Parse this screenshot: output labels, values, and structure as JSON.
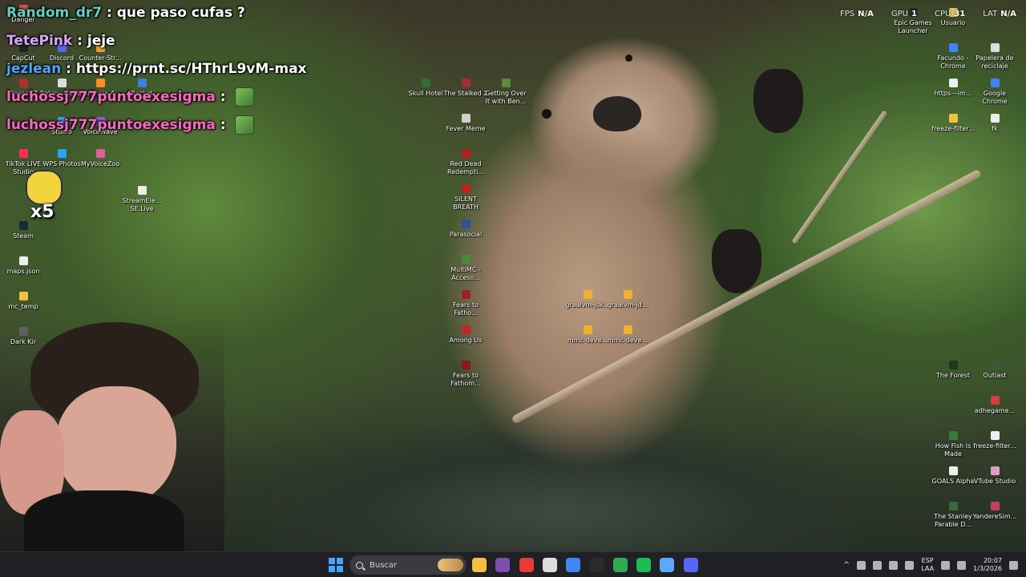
{
  "chat": {
    "messages": [
      {
        "user": "Random_dr7",
        "color": "#5fd0c4",
        "text": "que paso cufas ?",
        "emote": false
      },
      {
        "user": "TetePink",
        "color": "#d8a6ff",
        "text": "jeje",
        "emote": false
      },
      {
        "user": "jezlean",
        "color": "#4fa8ff",
        "text": "https://prnt.sc/HThrL9vM-max",
        "emote": false
      },
      {
        "user": "luchossj777puntoexesigma",
        "color": "#ff66c4",
        "text": "",
        "emote": true
      },
      {
        "user": "luchossj777puntoexesigma",
        "color": "#ff66c4",
        "text": "",
        "emote": true
      }
    ]
  },
  "stats": {
    "fps_label": "FPS",
    "fps_value": "N/A",
    "gpu_label": "GPU",
    "gpu_value": "1",
    "cpu_label": "CPU",
    "cpu_value": "31",
    "lat_label": "LAT",
    "lat_value": "N/A"
  },
  "boost": {
    "multiplier": "x5"
  },
  "desktop_icons": {
    "left": [
      {
        "label": "Danger",
        "color": "#d94f4f"
      },
      {
        "label": "CapCut",
        "color": "#222222"
      },
      {
        "label": "Discord",
        "color": "#5865f2"
      },
      {
        "label": "Counter-Str...",
        "color": "#e0a030"
      },
      {
        "label": "Project Z",
        "color": "#b03030"
      },
      {
        "label": "Roblox Player",
        "color": "#dddddd"
      },
      {
        "label": "naranoia-4...",
        "color": "#ff8c2a"
      },
      {
        "label": "Rocket",
        "color": "#3f7fe0"
      },
      {
        "label": "Studio",
        "color": "#3aa0ff"
      },
      {
        "label": "VoiceWave",
        "color": "#8f5fe0"
      },
      {
        "label": "TikTok LIVE Studio",
        "color": "#fe2c55"
      },
      {
        "label": "WPS Photos",
        "color": "#2aa0ff"
      },
      {
        "label": "MyVoiceZoo",
        "color": "#e05fa0"
      },
      {
        "label": "StreamEle... SE.Live",
        "color": "#eeeeee"
      },
      {
        "label": "Steam",
        "color": "#1b2838"
      },
      {
        "label": "maps.json",
        "color": "#eeeeee"
      },
      {
        "label": "mc_temp",
        "color": "#f0c040"
      },
      {
        "label": "Dark Kir",
        "color": "#606060"
      }
    ],
    "middle": [
      {
        "label": "Skull Hotel",
        "color": "#3a6a3a"
      },
      {
        "label": "The Stalked 2",
        "color": "#a03030"
      },
      {
        "label": "Getting Over It with Ben...",
        "color": "#5a8a3a"
      },
      {
        "label": "Fever Meme",
        "color": "#d0d0d0"
      },
      {
        "label": "Red Dead Redempti...",
        "color": "#b02020"
      },
      {
        "label": "SILENT BREATH",
        "color": "#c02020"
      },
      {
        "label": "Parasocial",
        "color": "#3050a0"
      },
      {
        "label": "MultiMC - Acceso...",
        "color": "#4a8a3a"
      },
      {
        "label": "Fears to Fatho...",
        "color": "#a02020"
      },
      {
        "label": "Among Us",
        "color": "#c02828"
      },
      {
        "label": "Fears to Fathom...",
        "color": "#8a1818"
      },
      {
        "label": "graalvm-jdk...",
        "color": "#f0b030"
      },
      {
        "label": "graalvm-jd...",
        "color": "#f0b030"
      },
      {
        "label": "mmc-deve...",
        "color": "#f0b030"
      },
      {
        "label": "mmc-deve...",
        "color": "#f0b030"
      }
    ],
    "right": [
      {
        "label": "Epic Games Launcher",
        "color": "#2a2a2a"
      },
      {
        "label": "Usuario",
        "color": "#e0c060"
      },
      {
        "label": "Facundo - Chrome",
        "color": "#4285f4"
      },
      {
        "label": "Papelera de reciclaje",
        "color": "#dddddd"
      },
      {
        "label": "https---im...",
        "color": "#eeeeee"
      },
      {
        "label": "Google Chrome",
        "color": "#4285f4"
      },
      {
        "label": "freeze-filter...",
        "color": "#f0c040"
      },
      {
        "label": "fk",
        "color": "#eeeeee"
      },
      {
        "label": "The Forest",
        "color": "#1a3a1a"
      },
      {
        "label": "Outlast",
        "color": "#3a5a3a"
      },
      {
        "label": "adhegame...",
        "color": "#d04040"
      },
      {
        "label": "How Fish Is Made",
        "color": "#3a7a3a"
      },
      {
        "label": "freeze-filter...",
        "color": "#eeeeee"
      },
      {
        "label": "GOALS Alpha",
        "color": "#eeeeee"
      },
      {
        "label": "VTube Studio",
        "color": "#e0a0c0"
      },
      {
        "label": "The Stanley Parable D...",
        "color": "#3a6a3a"
      },
      {
        "label": "YandereSim...",
        "color": "#c04060"
      }
    ]
  },
  "taskbar": {
    "search_placeholder": "Buscar",
    "apps": [
      {
        "name": "file-explorer",
        "color": "#f2c043"
      },
      {
        "name": "winrar",
        "color": "#7a4fb0"
      },
      {
        "name": "wps-office",
        "color": "#e83a3a"
      },
      {
        "name": "store",
        "color": "#dddddd"
      },
      {
        "name": "chrome",
        "color": "#4285f4"
      },
      {
        "name": "obs",
        "color": "#2b2b2b"
      },
      {
        "name": "chrome-profile",
        "color": "#34a853"
      },
      {
        "name": "spotify",
        "color": "#1db954"
      },
      {
        "name": "notepad",
        "color": "#5aa8ff"
      },
      {
        "name": "discord",
        "color": "#5865f2"
      }
    ],
    "language_top": "ESP",
    "language_bottom": "LAA",
    "time": "20:07",
    "date": "1/3/2026",
    "tray_chevron": "^"
  }
}
